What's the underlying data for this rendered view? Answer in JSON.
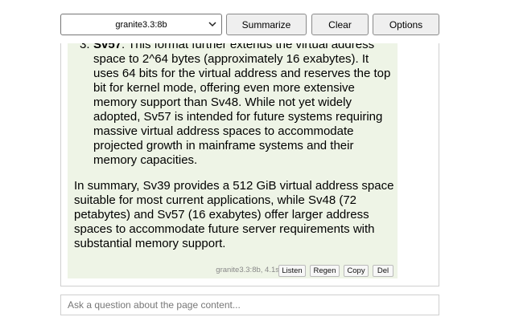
{
  "toolbar": {
    "model": "granite3.3:8b",
    "summarize_label": "Summarize",
    "clear_label": "Clear",
    "options_label": "Options"
  },
  "message": {
    "point3": {
      "number": "3.",
      "title": "Sv57",
      "text": ": This format further extends the virtual address space to 2^64 bytes (approximately 16 exabytes). It uses 64 bits for the virtual address and reserves the top bit for kernel mode, offering even more extensive memory support than Sv48. While not yet widely adopted, Sv57 is intended for future systems requiring massive virtual address spaces to accommodate projected growth in mainframe systems and their memory capacities."
    },
    "summary": "In summary, Sv39 provides a 512 GiB virtual address space suitable for most current applications, while Sv48 (72 petabytes) and Sv57 (16 exabytes) offer larger address spaces to accommodate future server requirements with substantial memory support.",
    "meta": "granite3.3:8b, 4.1s",
    "actions": {
      "listen": "Listen",
      "regen": "Regen",
      "copy": "Copy",
      "del": "Del"
    }
  },
  "ask": {
    "placeholder": "Ask a question about the page content..."
  }
}
